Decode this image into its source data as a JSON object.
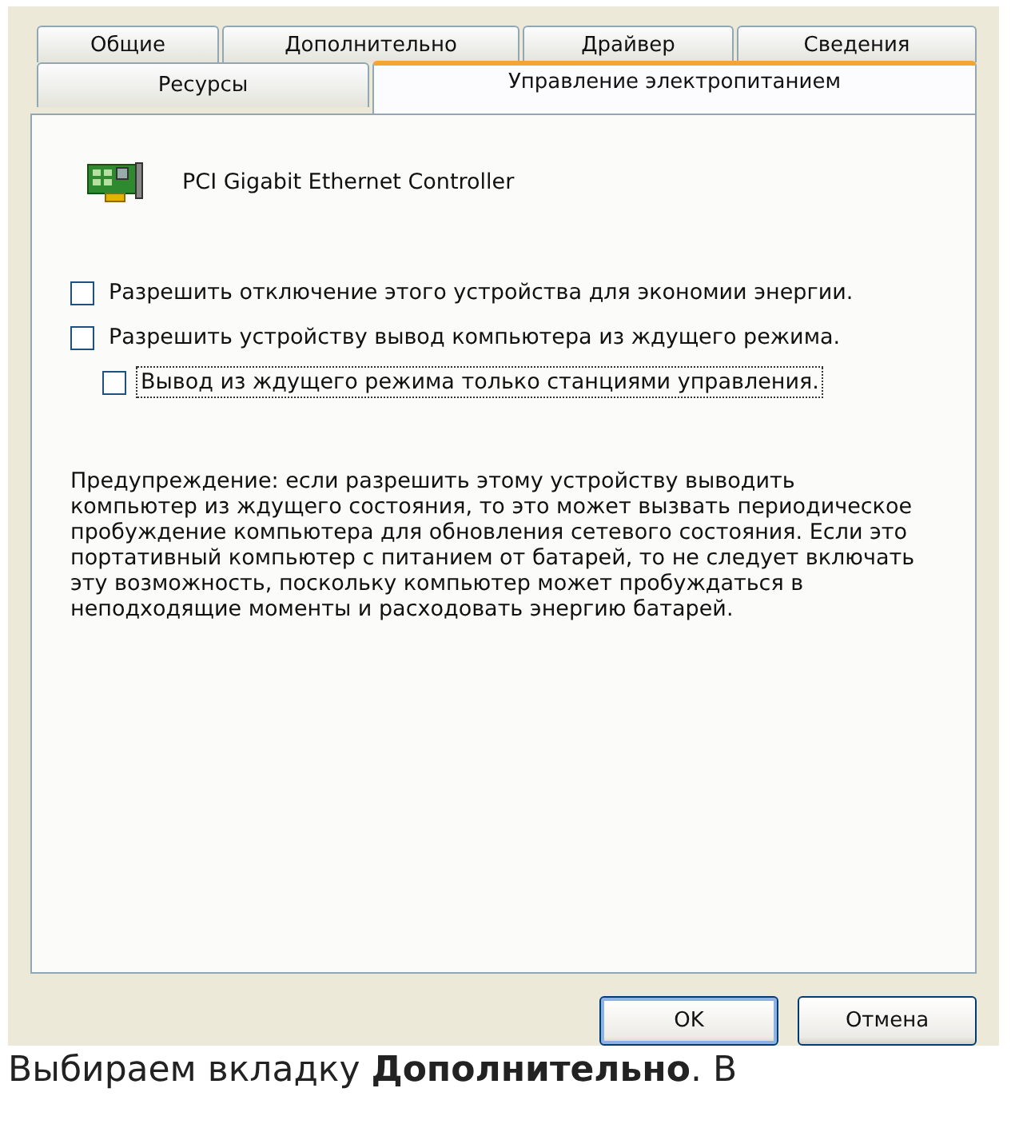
{
  "dialog": {
    "tab_rows": [
      [
        {
          "label": "Общие",
          "selected": false
        },
        {
          "label": "Дополнительно",
          "selected": false
        },
        {
          "label": "Драйвер",
          "selected": false
        },
        {
          "label": "Сведения",
          "selected": false
        }
      ],
      [
        {
          "label": "Ресурсы",
          "selected": false
        },
        {
          "label": "Управление электропитанием",
          "selected": true
        }
      ]
    ],
    "device": {
      "name": "PCI  Gigabit Ethernet Controller"
    },
    "options": [
      {
        "label": "Разрешить отключение этого устройства для экономии энергии.",
        "checked": false,
        "focused": false
      },
      {
        "label": "Разрешить устройству вывод компьютера из ждущего режима.",
        "checked": false,
        "focused": false,
        "children": [
          {
            "label": "Вывод из ждущего режима только станциями управления.",
            "checked": false,
            "focused": true
          }
        ]
      }
    ],
    "warning": "Предупреждение: если разрешить этому устройству выводить компьютер из ждущего состояния, то это может вызвать периодическое пробуждение компьютера для обновления сетевого состояния. Если это портативный компьютер с питанием от батарей, то не следует включать эту возможность, поскольку компьютер может пробуждаться в неподходящие моменты и расходовать энергию батарей.",
    "buttons": [
      {
        "label": "OK",
        "kind": "default"
      },
      {
        "label": "Отмена",
        "kind": "normal"
      }
    ]
  },
  "caption": "Выбираем вкладку **Дополнительно**. В"
}
